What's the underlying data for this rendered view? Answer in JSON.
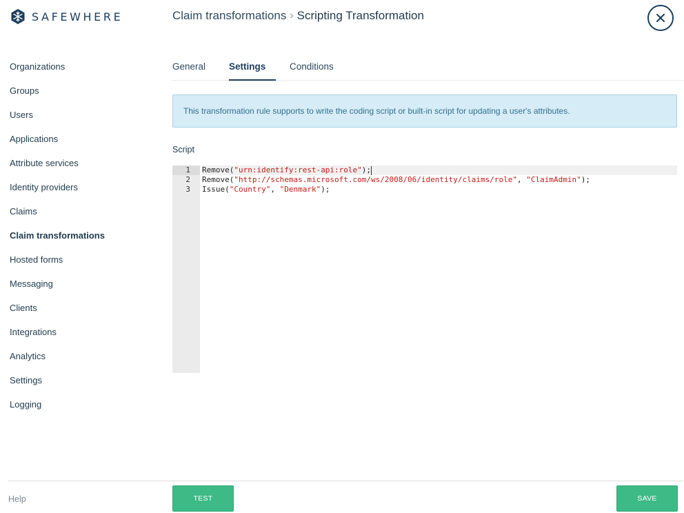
{
  "brand": {
    "name": "SAFEWHERE",
    "color": "#1a3d5c"
  },
  "header": {
    "breadcrumb_parent": "Claim transformations",
    "breadcrumb_separator": "›",
    "breadcrumb_current": "Scripting Transformation",
    "close_icon": "close-icon"
  },
  "sidebar": {
    "items": [
      {
        "label": "Organizations",
        "active": false
      },
      {
        "label": "Groups",
        "active": false
      },
      {
        "label": "Users",
        "active": false
      },
      {
        "label": "Applications",
        "active": false
      },
      {
        "label": "Attribute services",
        "active": false
      },
      {
        "label": "Identity providers",
        "active": false
      },
      {
        "label": "Claims",
        "active": false
      },
      {
        "label": "Claim transformations",
        "active": true
      },
      {
        "label": "Hosted forms",
        "active": false
      },
      {
        "label": "Messaging",
        "active": false
      },
      {
        "label": "Clients",
        "active": false
      },
      {
        "label": "Integrations",
        "active": false
      },
      {
        "label": "Analytics",
        "active": false
      },
      {
        "label": "Settings",
        "active": false
      },
      {
        "label": "Logging",
        "active": false
      }
    ]
  },
  "tabs": [
    {
      "label": "General",
      "active": false
    },
    {
      "label": "Settings",
      "active": true
    },
    {
      "label": "Conditions",
      "active": false
    }
  ],
  "info_message": "This transformation rule supports to write the coding script or built-in script for updating a user's attributes.",
  "script": {
    "label": "Script",
    "line_numbers": [
      "1",
      "2",
      "3"
    ],
    "lines": [
      "Remove(\"urn:identify:rest-api:role\");",
      "Remove(\"http://schemas.microsoft.com/ws/2008/06/identity/claims/role\", \"ClaimAdmin\");",
      "Issue(\"Country\", \"Denmark\");"
    ]
  },
  "footer": {
    "help_label": "Help",
    "test_label": "TEST",
    "save_label": "SAVE"
  },
  "colors": {
    "accent": "#3dba86",
    "info_bg": "#d6ecf6",
    "info_text": "#31708f",
    "string": "#c41a16"
  }
}
